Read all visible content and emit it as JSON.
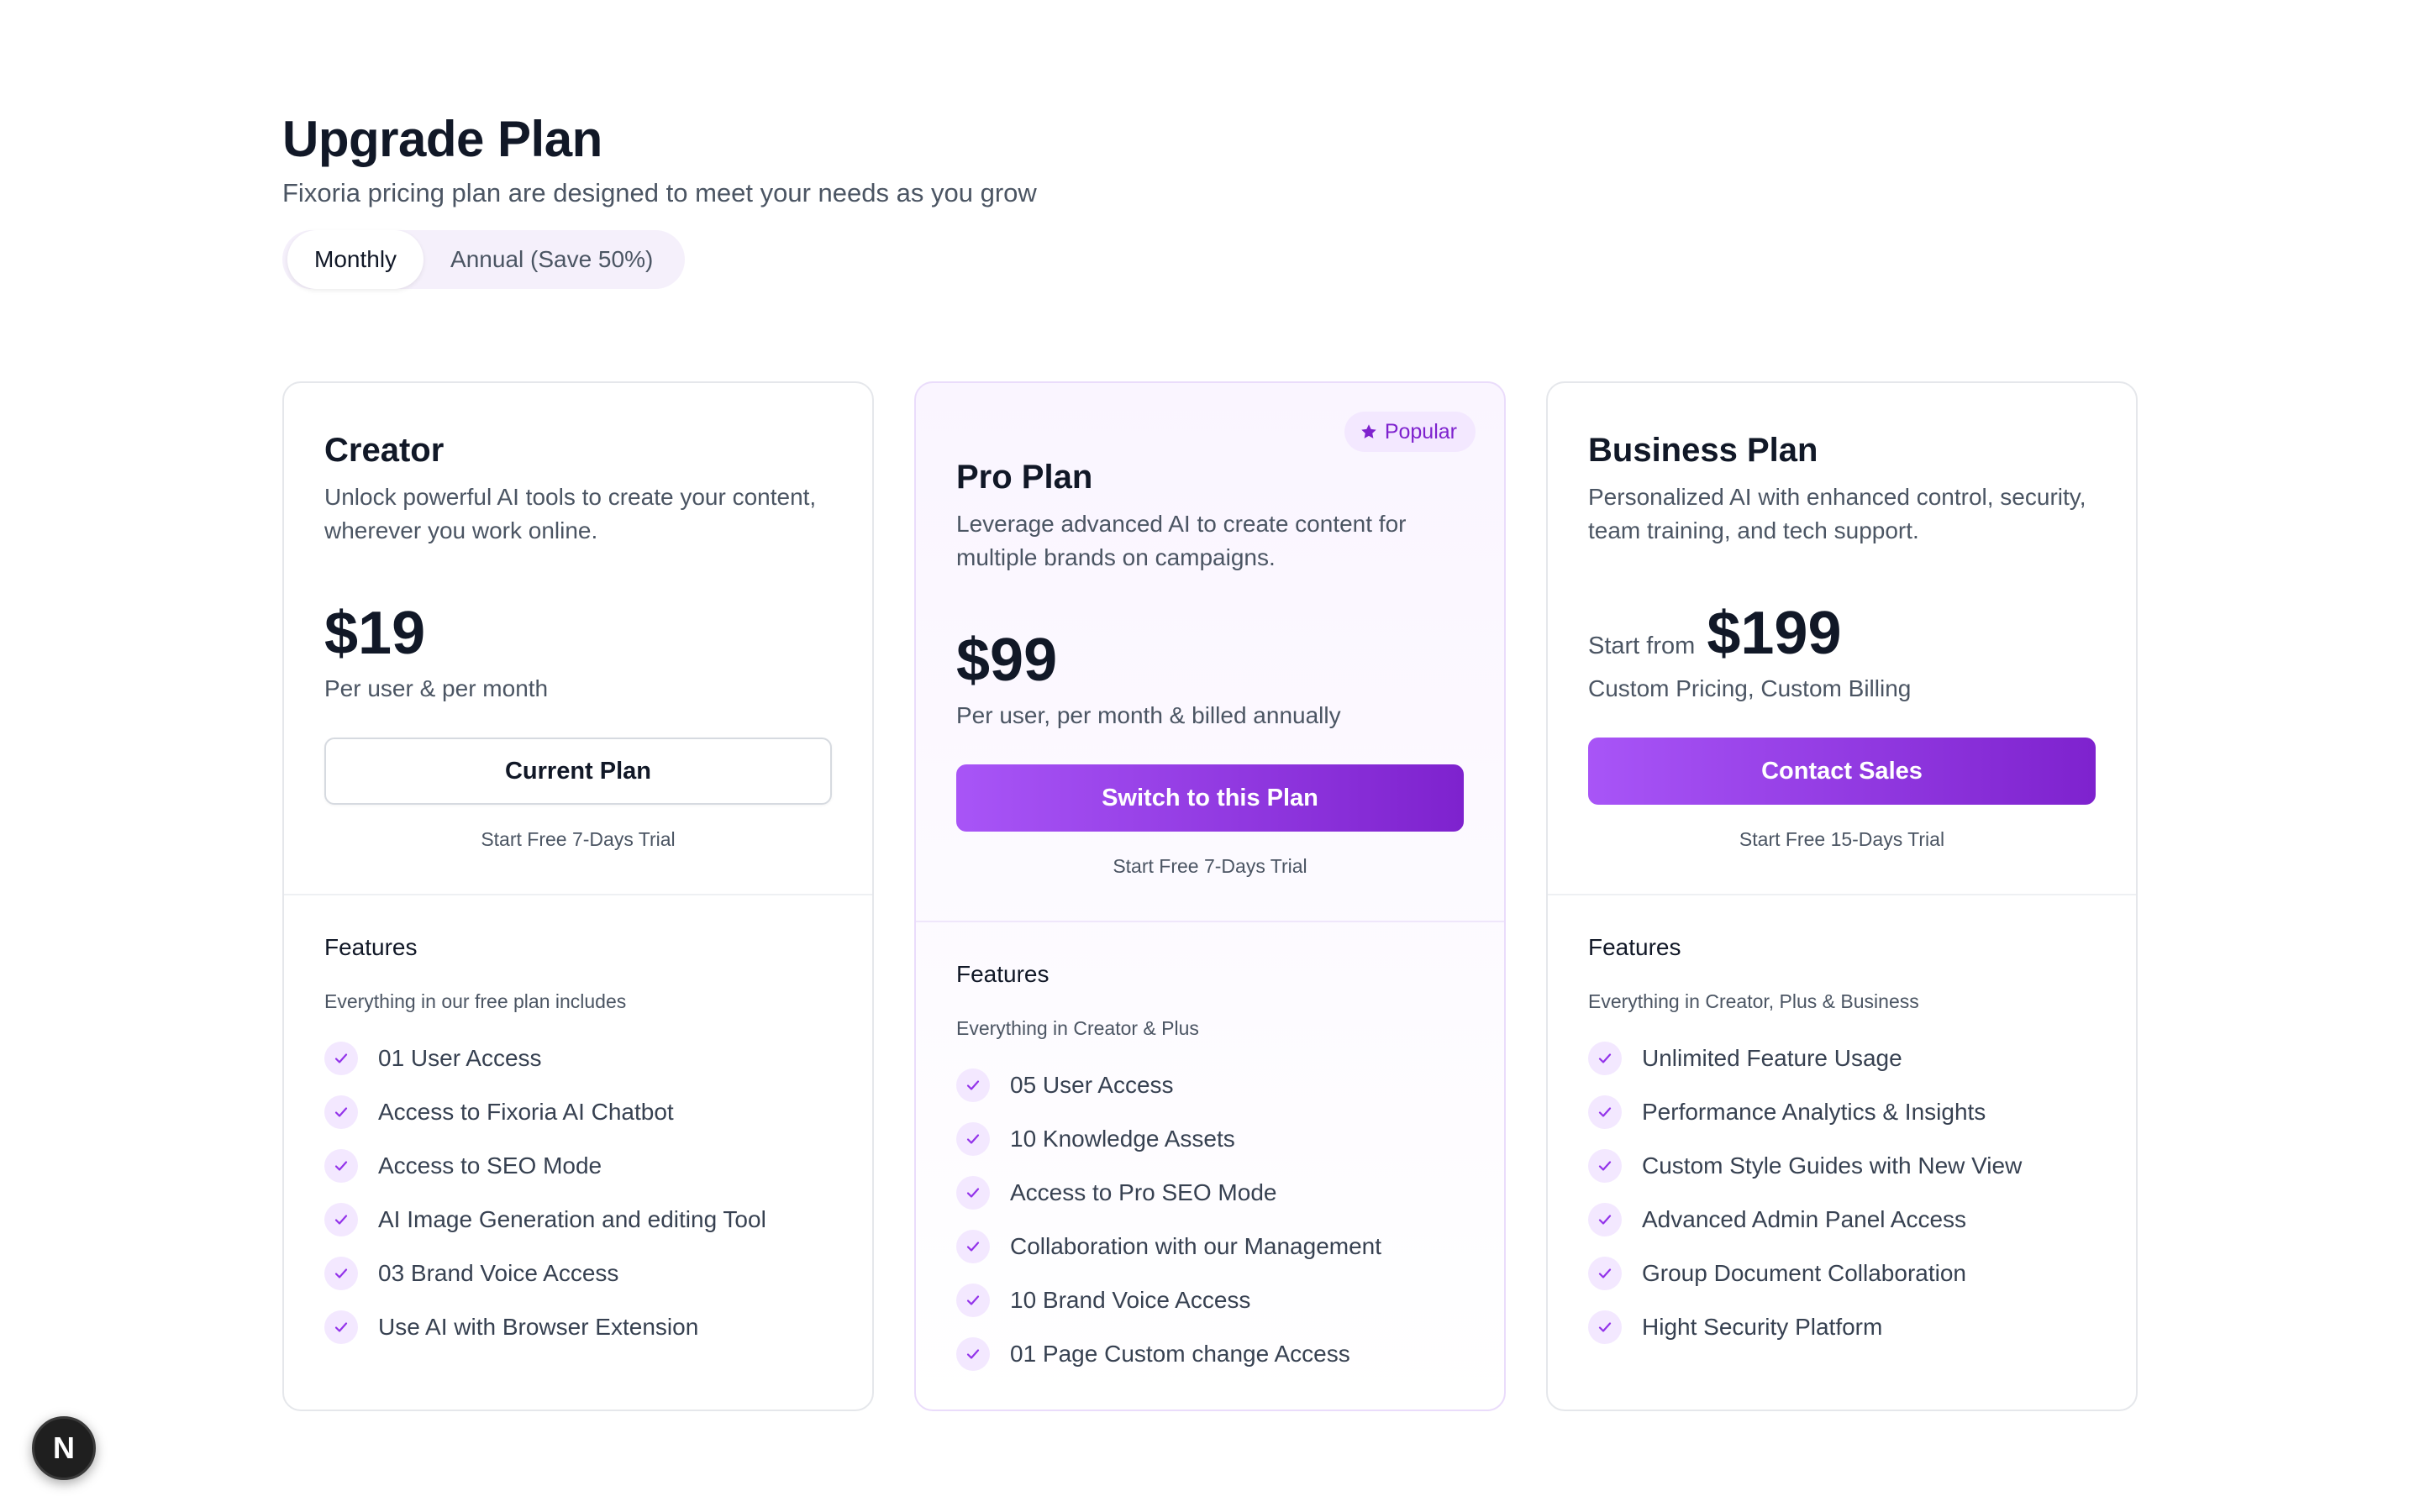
{
  "header": {
    "title": "Upgrade Plan",
    "subtitle": "Fixoria pricing plan are designed to meet your needs as you grow"
  },
  "billing_toggle": {
    "options": [
      "Monthly",
      "Annual (Save 50%)"
    ],
    "selected": "Monthly"
  },
  "plans": [
    {
      "name": "Creator",
      "description": "Unlock powerful AI tools to create your content, wherever you work online.",
      "price_prefix": "",
      "price": "$19",
      "price_note": "Per user & per month",
      "cta_label": "Current Plan",
      "trial": "Start Free 7-Days Trial",
      "features_title": "Features",
      "features_subtitle": "Everything in our free plan includes",
      "features": [
        "01 User Access",
        "Access to Fixoria AI Chatbot",
        "Access to SEO Mode",
        "AI Image Generation and editing Tool",
        "03 Brand Voice Access",
        "Use AI with Browser Extension"
      ]
    },
    {
      "name": "Pro Plan",
      "badge": "Popular",
      "description": "Leverage advanced AI to create content for multiple brands on campaigns.",
      "price_prefix": "",
      "price": "$99",
      "price_note": "Per user, per month & billed annually",
      "cta_label": "Switch to this Plan",
      "trial": "Start Free 7-Days Trial",
      "features_title": "Features",
      "features_subtitle": "Everything in Creator & Plus",
      "features": [
        "05 User Access",
        "10 Knowledge Assets",
        "Access to Pro SEO Mode",
        "Collaboration with our Management",
        "10 Brand Voice Access",
        "01 Page Custom change Access"
      ]
    },
    {
      "name": "Business Plan",
      "description": "Personalized AI with enhanced control, security, team training, and tech support.",
      "price_prefix": "Start from",
      "price": "$199",
      "price_note": "Custom Pricing, Custom Billing",
      "cta_label": "Contact Sales",
      "trial": "Start Free 15-Days Trial",
      "features_title": "Features",
      "features_subtitle": "Everything in Creator, Plus & Business",
      "features": [
        "Unlimited Feature Usage",
        "Performance Analytics & Insights",
        "Custom Style Guides with New View",
        "Advanced Admin Panel Access",
        "Group Document Collaboration",
        "Hight Security Platform"
      ]
    }
  ],
  "dev_badge": {
    "letter": "N",
    "icon": "nextjs-icon"
  },
  "colors": {
    "accent_start": "#a855f7",
    "accent_end": "#7e22ce",
    "check_bg": "#f3e8ff",
    "check_color": "#9333ea",
    "text_primary": "#111827",
    "text_secondary": "#4b5563"
  }
}
